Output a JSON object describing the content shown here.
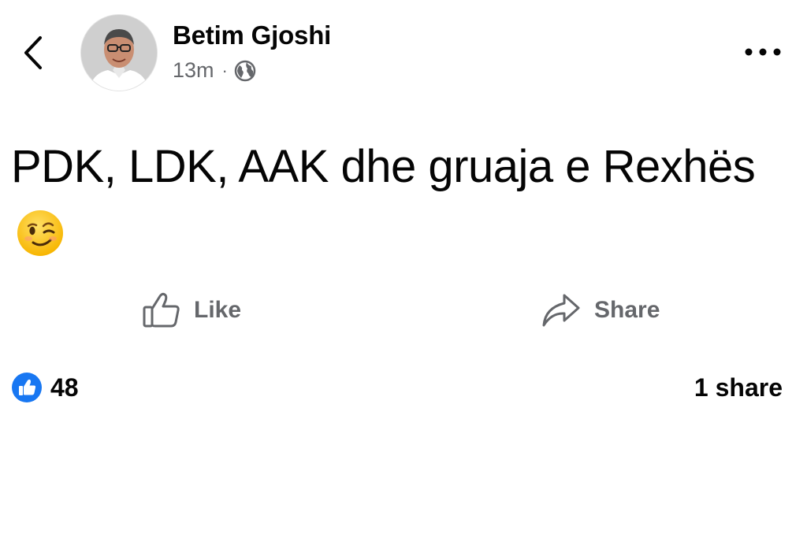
{
  "header": {
    "back_icon": "chevron-left-icon",
    "author_name": "Betim Gjoshi",
    "timestamp": "13m",
    "separator": "·",
    "audience_icon": "globe-icon",
    "more_icon": "more-horizontal-icon"
  },
  "post": {
    "text": "PDK, LDK, AAK dhe gruaja e Rexhës",
    "emoji_icon": "winking-face-emoji"
  },
  "actions": {
    "like_label": "Like",
    "like_icon": "thumbs-up-icon",
    "share_label": "Share",
    "share_icon": "share-arrow-icon"
  },
  "stats": {
    "reaction_icon": "like-reaction-icon",
    "reaction_count": "48",
    "shares_text": "1 share"
  },
  "colors": {
    "secondary_text": "#65676b",
    "like_blue": "#1877f2",
    "emoji_yellow": "#ffcc33"
  }
}
